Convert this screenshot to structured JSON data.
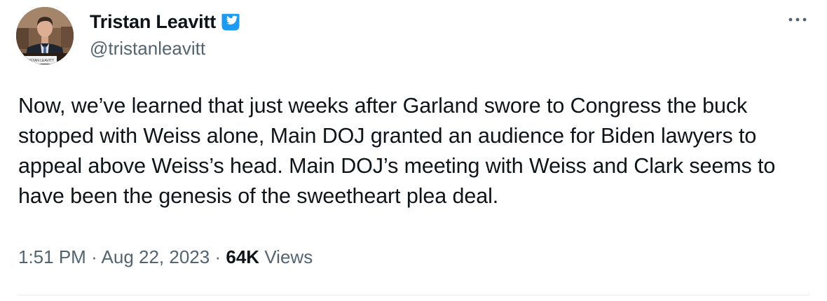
{
  "author": {
    "display_name": "Tristan Leavitt",
    "handle": "@tristanleavitt",
    "verified": true,
    "avatar": "profile-photo",
    "avatar_placard": "TRISTAN LEAVITT"
  },
  "tweet": {
    "text": "Now, we’ve learned that just weeks after Garland swore to Congress the buck stopped with Weiss alone, Main DOJ granted an audience for Biden lawyers to appeal above Weiss’s head. Main DOJ’s meeting with Weiss and Clark seems to have been the genesis of the sweetheart plea deal.",
    "time": "1:51 PM",
    "separator": "·",
    "date": "Aug 22, 2023",
    "views_count": "64K",
    "views_label": "Views"
  },
  "icons": {
    "verified": "verified-badge-icon",
    "more": "more-options-icon"
  },
  "colors": {
    "text_primary": "#0f1419",
    "text_secondary": "#536471",
    "verified_blue": "#1d9bf0",
    "divider": "#e7e9ea"
  }
}
